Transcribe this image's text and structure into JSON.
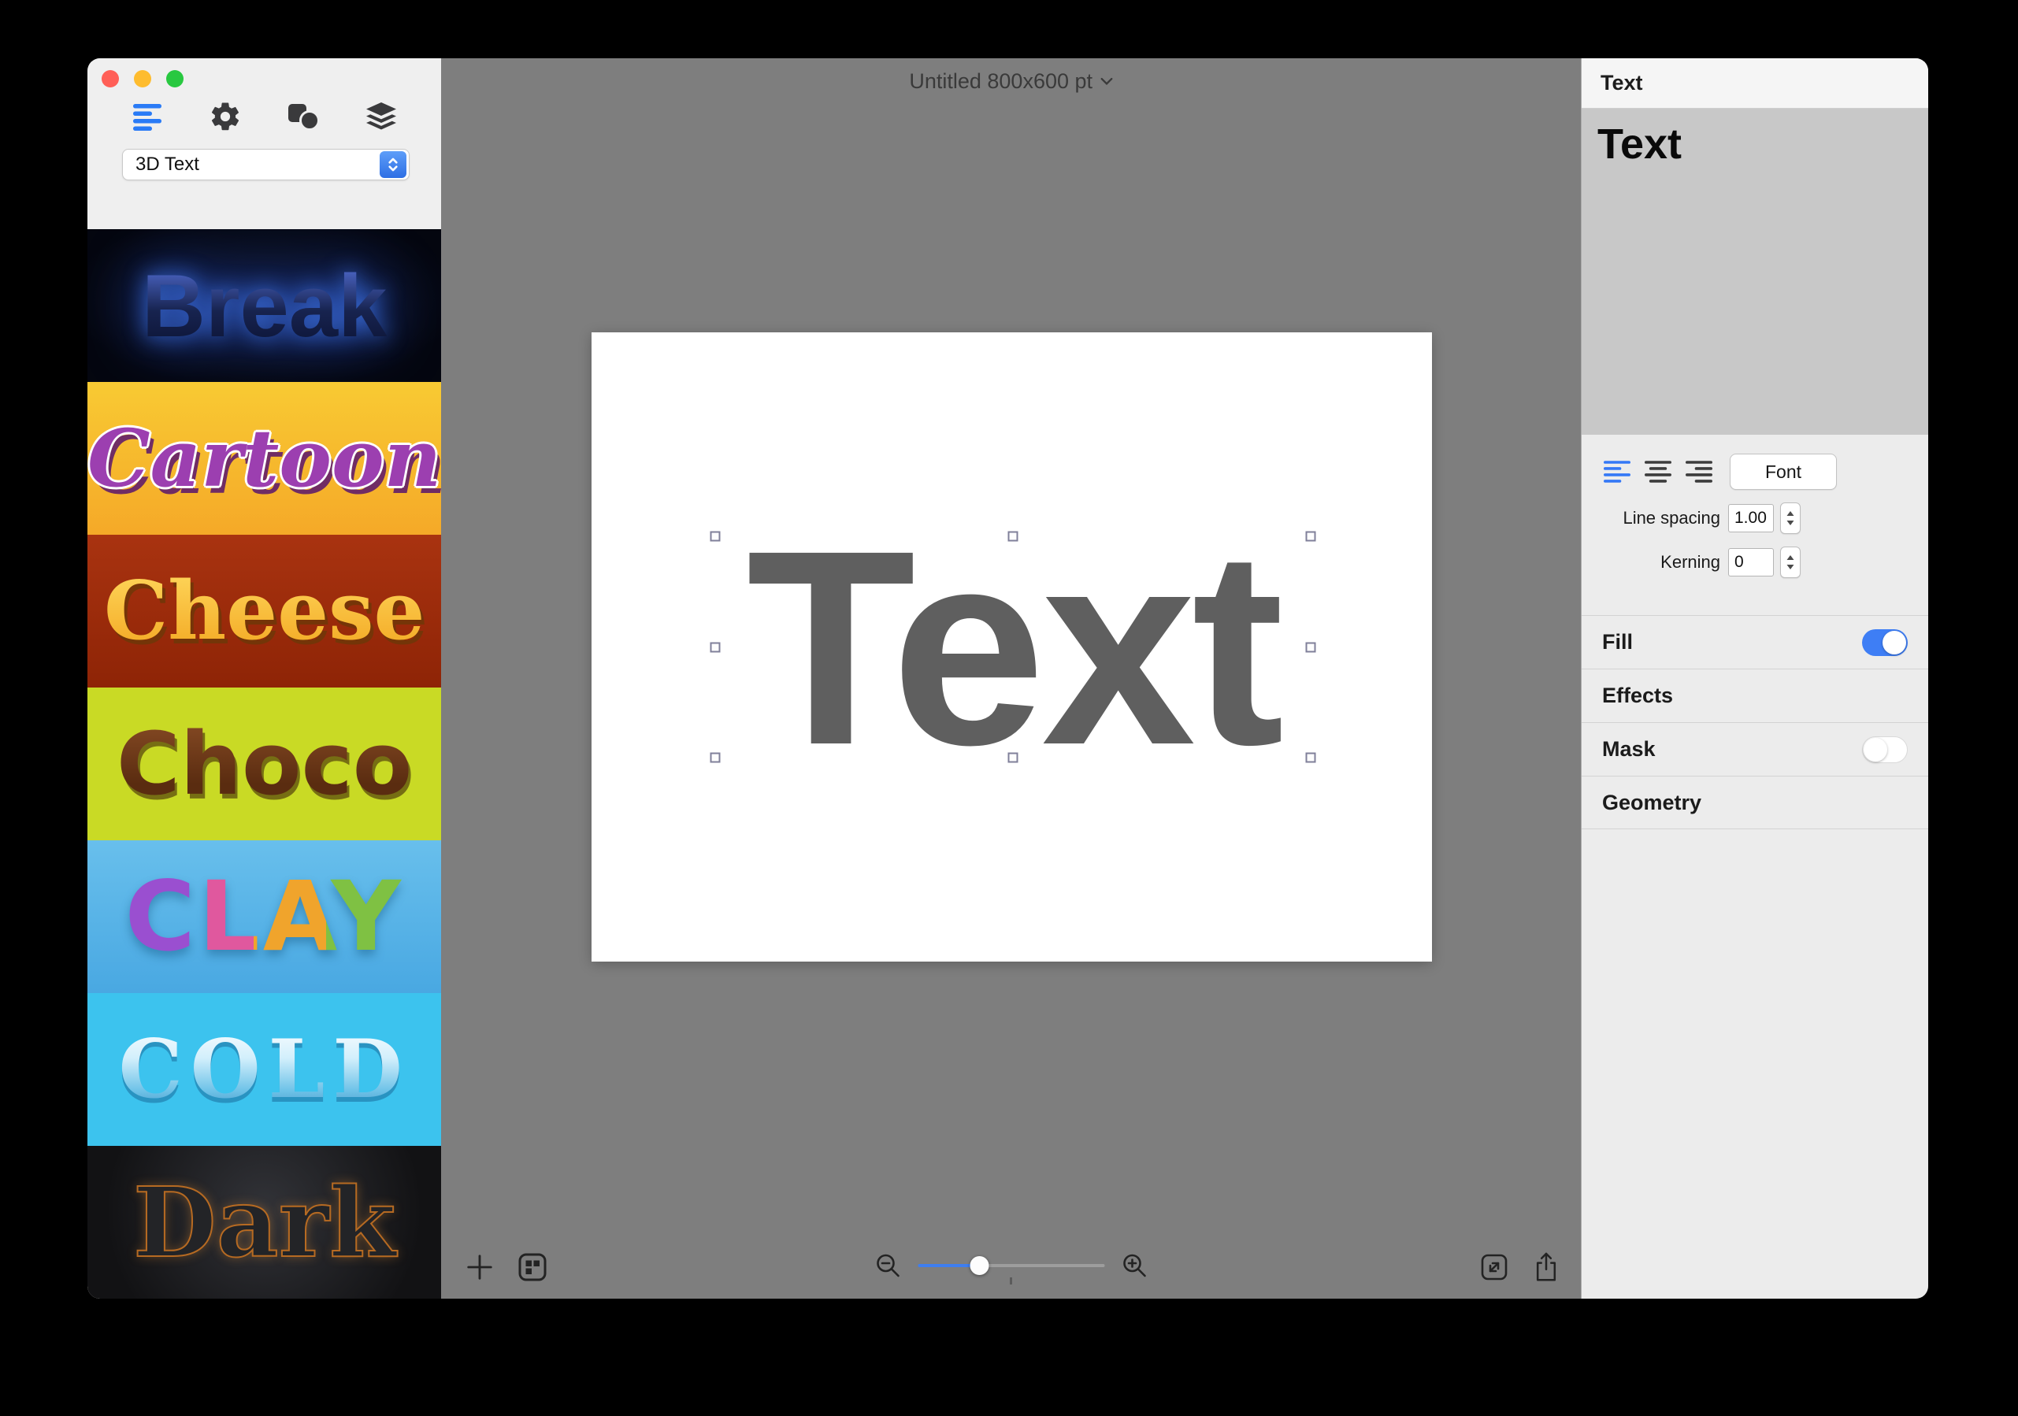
{
  "window": {
    "title": "Untitled 800x600 pt"
  },
  "sidebar": {
    "category_dropdown": {
      "value": "3D Text"
    },
    "styles": [
      {
        "name": "Break",
        "bg": "#05070f"
      },
      {
        "name": "Cartoon",
        "bg": "#f6bd2d"
      },
      {
        "name": "Cheese",
        "bg": "#9e2c09"
      },
      {
        "name": "Choco",
        "bg": "#c9da25"
      },
      {
        "name": "CLAY",
        "bg": "#58b6e9"
      },
      {
        "name": "COLD",
        "bg": "#3cc3ee"
      },
      {
        "name": "Dark",
        "bg": "#1c1d20"
      }
    ]
  },
  "canvas": {
    "artboard_text": "Text"
  },
  "inspector": {
    "panel_title": "Text",
    "text_content": "Text",
    "font_button": "Font",
    "line_spacing": {
      "label": "Line spacing",
      "value": "1.00"
    },
    "kerning": {
      "label": "Kerning",
      "value": "0"
    },
    "sections": {
      "fill": {
        "label": "Fill",
        "enabled": true
      },
      "effects": {
        "label": "Effects"
      },
      "mask": {
        "label": "Mask",
        "enabled": false
      },
      "geometry": {
        "label": "Geometry"
      }
    }
  },
  "icons": {
    "styles-list-icon": "bars",
    "settings-gear-icon": "gear",
    "shapes-icon": "square-and-circle",
    "layers-icon": "stacked-layers",
    "popup-arrows-icon": "up-down-chevrons",
    "title-chevron-icon": "chevron-down",
    "add-icon": "plus",
    "templates-icon": "grid-square",
    "zoom-out-icon": "magnifier-minus",
    "zoom-in-icon": "magnifier-plus",
    "scale-icon": "diagonal-arrows-square",
    "share-icon": "box-arrow-up",
    "align-left-icon": "lines-left",
    "align-center-icon": "lines-center",
    "align-right-icon": "lines-right",
    "stepper-icon": "up-down-triangles"
  },
  "colors": {
    "accent": "#3478f6",
    "canvas_bg": "#7e7e7e",
    "artboard_text": "#5f5f5f",
    "traffic_red": "#ff5f57",
    "traffic_yellow": "#febc2e",
    "traffic_green": "#28c840",
    "toggle_on": "#3e7ef5"
  }
}
